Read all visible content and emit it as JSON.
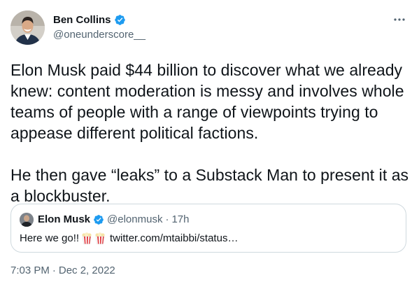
{
  "author": {
    "display_name": "Ben Collins",
    "handle": "@oneunderscore__",
    "verified": true,
    "avatar_icon": "person-avatar"
  },
  "menu": {
    "more_icon": "more-dots-icon"
  },
  "tweet": {
    "paragraphs": [
      "Elon Musk paid $44 billion to discover what we already knew: content moderation is messy and involves whole teams of people with a range of viewpoints trying to appease different political factions.",
      "He then gave “leaks” to a Substack Man to present it as a blockbuster."
    ]
  },
  "quote": {
    "display_name": "Elon Musk",
    "handle": "@elonmusk",
    "separator": "·",
    "time": "17h",
    "text": "Here we go!!",
    "emoji_icons": [
      "popcorn-icon",
      "popcorn-icon"
    ],
    "link": "twitter.com/mtaibbi/status…",
    "verified": true
  },
  "footer": {
    "time": "7:03 PM",
    "separator": "·",
    "date": "Dec 2, 2022"
  },
  "colors": {
    "text": "#0f1419",
    "secondary": "#536471",
    "verified_blue": "#1d9bf0",
    "border": "#cfd9de"
  }
}
